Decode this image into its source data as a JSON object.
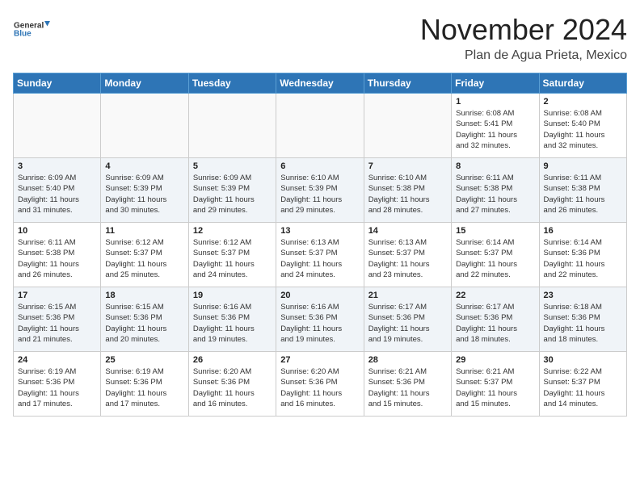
{
  "header": {
    "logo": {
      "line1": "General",
      "line2": "Blue"
    },
    "month": "November 2024",
    "location": "Plan de Agua Prieta, Mexico"
  },
  "weekdays": [
    "Sunday",
    "Monday",
    "Tuesday",
    "Wednesday",
    "Thursday",
    "Friday",
    "Saturday"
  ],
  "weeks": [
    [
      {
        "day": "",
        "info": ""
      },
      {
        "day": "",
        "info": ""
      },
      {
        "day": "",
        "info": ""
      },
      {
        "day": "",
        "info": ""
      },
      {
        "day": "",
        "info": ""
      },
      {
        "day": "1",
        "info": "Sunrise: 6:08 AM\nSunset: 5:41 PM\nDaylight: 11 hours\nand 32 minutes."
      },
      {
        "day": "2",
        "info": "Sunrise: 6:08 AM\nSunset: 5:40 PM\nDaylight: 11 hours\nand 32 minutes."
      }
    ],
    [
      {
        "day": "3",
        "info": "Sunrise: 6:09 AM\nSunset: 5:40 PM\nDaylight: 11 hours\nand 31 minutes."
      },
      {
        "day": "4",
        "info": "Sunrise: 6:09 AM\nSunset: 5:39 PM\nDaylight: 11 hours\nand 30 minutes."
      },
      {
        "day": "5",
        "info": "Sunrise: 6:09 AM\nSunset: 5:39 PM\nDaylight: 11 hours\nand 29 minutes."
      },
      {
        "day": "6",
        "info": "Sunrise: 6:10 AM\nSunset: 5:39 PM\nDaylight: 11 hours\nand 29 minutes."
      },
      {
        "day": "7",
        "info": "Sunrise: 6:10 AM\nSunset: 5:38 PM\nDaylight: 11 hours\nand 28 minutes."
      },
      {
        "day": "8",
        "info": "Sunrise: 6:11 AM\nSunset: 5:38 PM\nDaylight: 11 hours\nand 27 minutes."
      },
      {
        "day": "9",
        "info": "Sunrise: 6:11 AM\nSunset: 5:38 PM\nDaylight: 11 hours\nand 26 minutes."
      }
    ],
    [
      {
        "day": "10",
        "info": "Sunrise: 6:11 AM\nSunset: 5:38 PM\nDaylight: 11 hours\nand 26 minutes."
      },
      {
        "day": "11",
        "info": "Sunrise: 6:12 AM\nSunset: 5:37 PM\nDaylight: 11 hours\nand 25 minutes."
      },
      {
        "day": "12",
        "info": "Sunrise: 6:12 AM\nSunset: 5:37 PM\nDaylight: 11 hours\nand 24 minutes."
      },
      {
        "day": "13",
        "info": "Sunrise: 6:13 AM\nSunset: 5:37 PM\nDaylight: 11 hours\nand 24 minutes."
      },
      {
        "day": "14",
        "info": "Sunrise: 6:13 AM\nSunset: 5:37 PM\nDaylight: 11 hours\nand 23 minutes."
      },
      {
        "day": "15",
        "info": "Sunrise: 6:14 AM\nSunset: 5:37 PM\nDaylight: 11 hours\nand 22 minutes."
      },
      {
        "day": "16",
        "info": "Sunrise: 6:14 AM\nSunset: 5:36 PM\nDaylight: 11 hours\nand 22 minutes."
      }
    ],
    [
      {
        "day": "17",
        "info": "Sunrise: 6:15 AM\nSunset: 5:36 PM\nDaylight: 11 hours\nand 21 minutes."
      },
      {
        "day": "18",
        "info": "Sunrise: 6:15 AM\nSunset: 5:36 PM\nDaylight: 11 hours\nand 20 minutes."
      },
      {
        "day": "19",
        "info": "Sunrise: 6:16 AM\nSunset: 5:36 PM\nDaylight: 11 hours\nand 19 minutes."
      },
      {
        "day": "20",
        "info": "Sunrise: 6:16 AM\nSunset: 5:36 PM\nDaylight: 11 hours\nand 19 minutes."
      },
      {
        "day": "21",
        "info": "Sunrise: 6:17 AM\nSunset: 5:36 PM\nDaylight: 11 hours\nand 19 minutes."
      },
      {
        "day": "22",
        "info": "Sunrise: 6:17 AM\nSunset: 5:36 PM\nDaylight: 11 hours\nand 18 minutes."
      },
      {
        "day": "23",
        "info": "Sunrise: 6:18 AM\nSunset: 5:36 PM\nDaylight: 11 hours\nand 18 minutes."
      }
    ],
    [
      {
        "day": "24",
        "info": "Sunrise: 6:19 AM\nSunset: 5:36 PM\nDaylight: 11 hours\nand 17 minutes."
      },
      {
        "day": "25",
        "info": "Sunrise: 6:19 AM\nSunset: 5:36 PM\nDaylight: 11 hours\nand 17 minutes."
      },
      {
        "day": "26",
        "info": "Sunrise: 6:20 AM\nSunset: 5:36 PM\nDaylight: 11 hours\nand 16 minutes."
      },
      {
        "day": "27",
        "info": "Sunrise: 6:20 AM\nSunset: 5:36 PM\nDaylight: 11 hours\nand 16 minutes."
      },
      {
        "day": "28",
        "info": "Sunrise: 6:21 AM\nSunset: 5:36 PM\nDaylight: 11 hours\nand 15 minutes."
      },
      {
        "day": "29",
        "info": "Sunrise: 6:21 AM\nSunset: 5:37 PM\nDaylight: 11 hours\nand 15 minutes."
      },
      {
        "day": "30",
        "info": "Sunrise: 6:22 AM\nSunset: 5:37 PM\nDaylight: 11 hours\nand 14 minutes."
      }
    ]
  ]
}
